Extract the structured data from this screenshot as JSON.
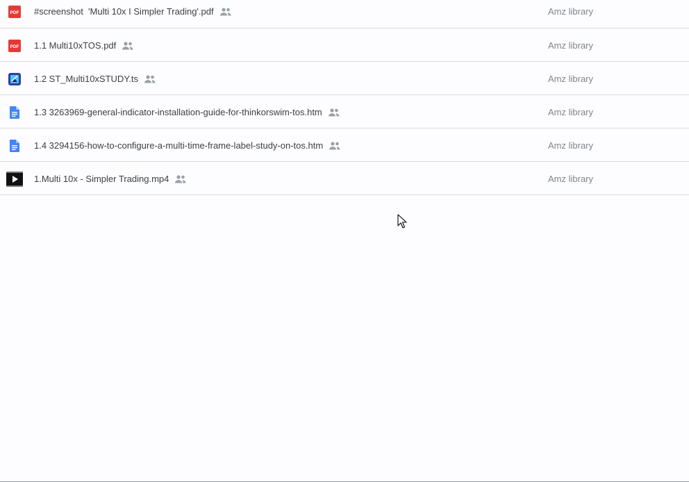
{
  "files": [
    {
      "name": "#screenshot  'Multi 10x I Simpler Trading'.pdf",
      "type": "pdf",
      "icon": "pdf-icon",
      "shared": true,
      "owner": "Amz library"
    },
    {
      "name": "1.1 Multi10xTOS.pdf",
      "type": "pdf",
      "icon": "pdf-icon",
      "shared": true,
      "owner": "Amz library"
    },
    {
      "name": "1.2 ST_Multi10xSTUDY.ts",
      "type": "image",
      "icon": "image-file-icon",
      "shared": true,
      "owner": "Amz library"
    },
    {
      "name": "1.3 3263969-general-indicator-installation-guide-for-thinkorswim-tos.htm",
      "type": "doc",
      "icon": "document-icon",
      "shared": true,
      "owner": "Amz library"
    },
    {
      "name": "1.4 3294156-how-to-configure-a-multi-time-frame-label-study-on-tos.htm",
      "type": "doc",
      "icon": "document-icon",
      "shared": true,
      "owner": "Amz library"
    },
    {
      "name": "1.Multi 10x - Simpler Trading.mp4",
      "type": "video",
      "icon": "video-icon",
      "shared": true,
      "owner": "Amz library"
    }
  ],
  "icons": {
    "pdf_text": "PDF"
  },
  "colors": {
    "pdf": "#e53935",
    "doc": "#4285f4",
    "image": "#3f51b5",
    "video": "#111111",
    "shared_icon": "#9aa0a6"
  }
}
